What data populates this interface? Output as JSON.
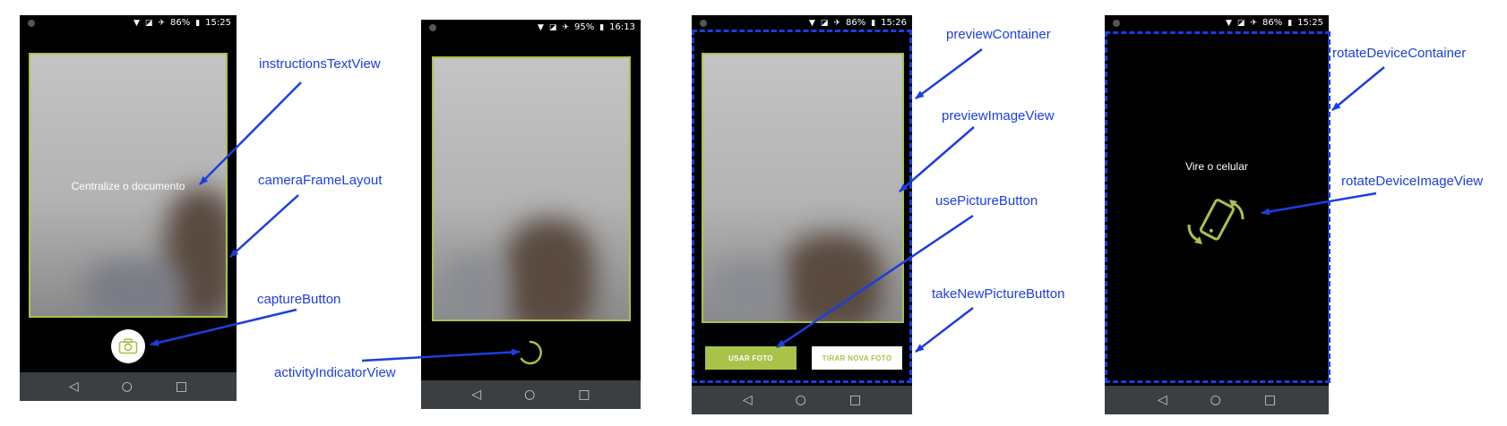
{
  "screens": [
    {
      "status": {
        "battery": "86%",
        "time": "15:25"
      },
      "instructions": "Centralize o documento"
    },
    {
      "status": {
        "battery": "95%",
        "time": "16:13"
      }
    },
    {
      "status": {
        "battery": "86%",
        "time": "15:26"
      },
      "use_picture": "USAR FOTO",
      "take_new_picture": "TIRAR NOVA FOTO"
    },
    {
      "status": {
        "battery": "86%",
        "time": "15:25"
      },
      "rotate_message": "Vire o celular"
    }
  ],
  "labels": {
    "instructionsTextView": "instructionsTextView",
    "cameraFrameLayout": "cameraFrameLayout",
    "captureButton": "captureButton",
    "activityIndicatorView": "activityIndicatorView",
    "previewContainer": "previewContainer",
    "previewImageView": "previewImageView",
    "usePictureButton": "usePictureButton",
    "takeNewPictureButton": "takeNewPictureButton",
    "rotateDeviceContainer": "rotateDeviceContainer",
    "rotateDeviceImageView": "rotateDeviceImageView"
  },
  "nav_icons": [
    "back-triangle",
    "home-circle",
    "recents-square"
  ],
  "colors": {
    "accent": "#a8c24a",
    "annotation": "#1a3fe0",
    "navbar": "#3b3f42"
  }
}
